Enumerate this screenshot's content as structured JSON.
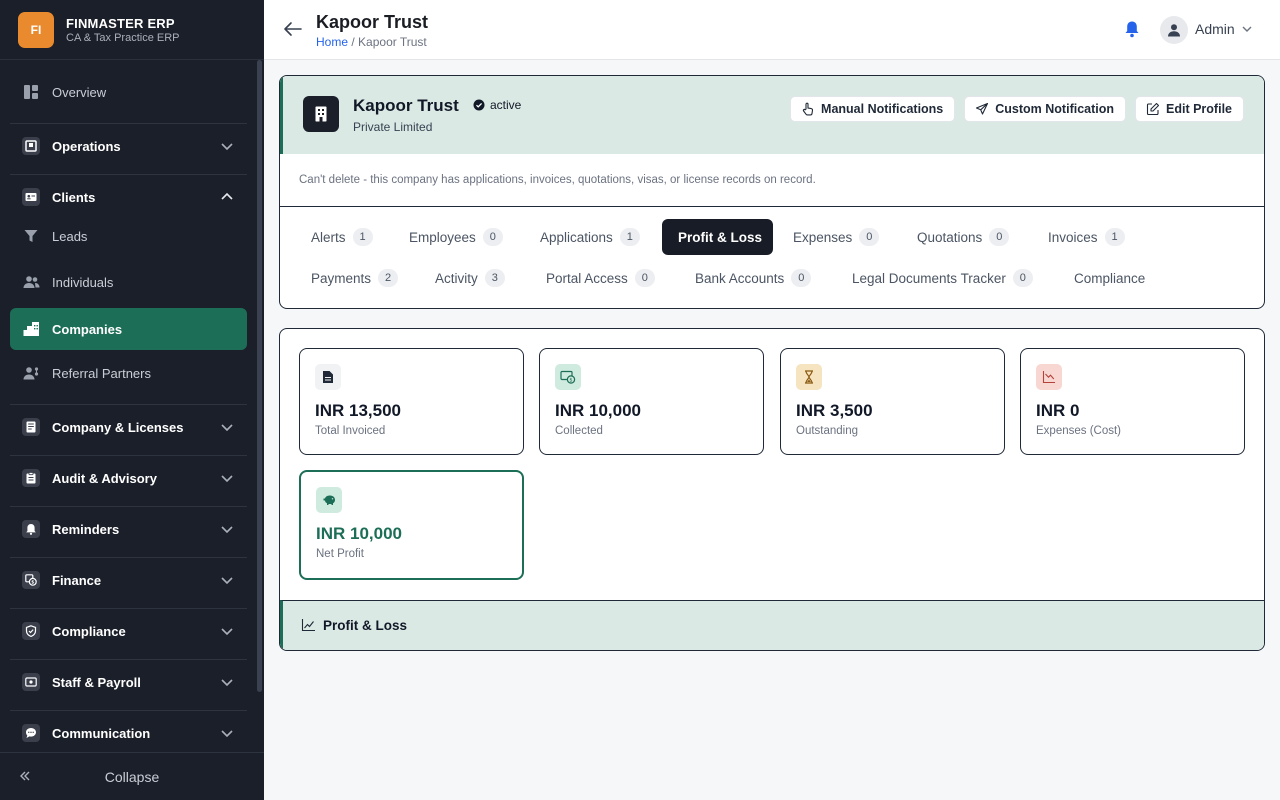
{
  "brand": {
    "logo": "FI",
    "name": "FINMASTER ERP",
    "subtitle": "CA & Tax Practice ERP"
  },
  "sidebar": {
    "items": [
      {
        "label": "Overview",
        "icon": "grid-icon"
      },
      {
        "label": "Operations",
        "icon": "operations-icon"
      },
      {
        "label": "Clients",
        "icon": "id-card-icon"
      },
      {
        "label": "Leads",
        "icon": "funnel-icon"
      },
      {
        "label": "Individuals",
        "icon": "users-icon"
      },
      {
        "label": "Companies",
        "icon": "buildings-icon"
      },
      {
        "label": "Referral Partners",
        "icon": "user-share-icon"
      },
      {
        "label": "Company & Licenses",
        "icon": "license-icon"
      },
      {
        "label": "Audit & Advisory",
        "icon": "clipboard-icon"
      },
      {
        "label": "Reminders",
        "icon": "bell-icon"
      },
      {
        "label": "Finance",
        "icon": "finance-icon"
      },
      {
        "label": "Compliance",
        "icon": "shield-icon"
      },
      {
        "label": "Staff & Payroll",
        "icon": "wallet-icon"
      },
      {
        "label": "Communication",
        "icon": "chat-icon"
      }
    ],
    "collapse_label": "Collapse"
  },
  "header": {
    "title": "Kapoor Trust",
    "breadcrumb_home": "Home",
    "breadcrumb_sep": "/",
    "breadcrumb_current": "Kapoor Trust",
    "user": "Admin"
  },
  "company": {
    "name": "Kapoor Trust",
    "status": "active",
    "type": "Private Limited",
    "notice": "Can't delete - this company has applications, invoices, quotations, visas, or license records on record."
  },
  "actions": {
    "manual": "Manual Notifications",
    "custom": "Custom Notification",
    "edit": "Edit Profile"
  },
  "tabs": [
    {
      "label": "Alerts",
      "count": "1"
    },
    {
      "label": "Employees",
      "count": "0"
    },
    {
      "label": "Applications",
      "count": "1"
    },
    {
      "label": "Profit & Loss",
      "count": ""
    },
    {
      "label": "Expenses",
      "count": "0"
    },
    {
      "label": "Quotations",
      "count": "0"
    },
    {
      "label": "Invoices",
      "count": "1"
    },
    {
      "label": "Payments",
      "count": "2"
    },
    {
      "label": "Activity",
      "count": "3"
    },
    {
      "label": "Portal Access",
      "count": "0"
    },
    {
      "label": "Bank Accounts",
      "count": "0"
    },
    {
      "label": "Legal Documents Tracker",
      "count": "0"
    },
    {
      "label": "Compliance",
      "count": ""
    }
  ],
  "stats": [
    {
      "value": "INR 13,500",
      "label": "Total Invoiced",
      "icon": "document-icon"
    },
    {
      "value": "INR 10,000",
      "label": "Collected",
      "icon": "cash-icon"
    },
    {
      "value": "INR 3,500",
      "label": "Outstanding",
      "icon": "hourglass-icon"
    },
    {
      "value": "INR 0",
      "label": "Expenses (Cost)",
      "icon": "trend-down-icon"
    },
    {
      "value": "INR 10,000",
      "label": "Net Profit",
      "icon": "piggy-bank-icon"
    }
  ],
  "section": {
    "title": "Profit & Loss"
  },
  "colors": {
    "accent": "#1d6e57",
    "sidebar": "#1b1f29",
    "brand": "#ea8a2e",
    "link": "#2563eb"
  }
}
